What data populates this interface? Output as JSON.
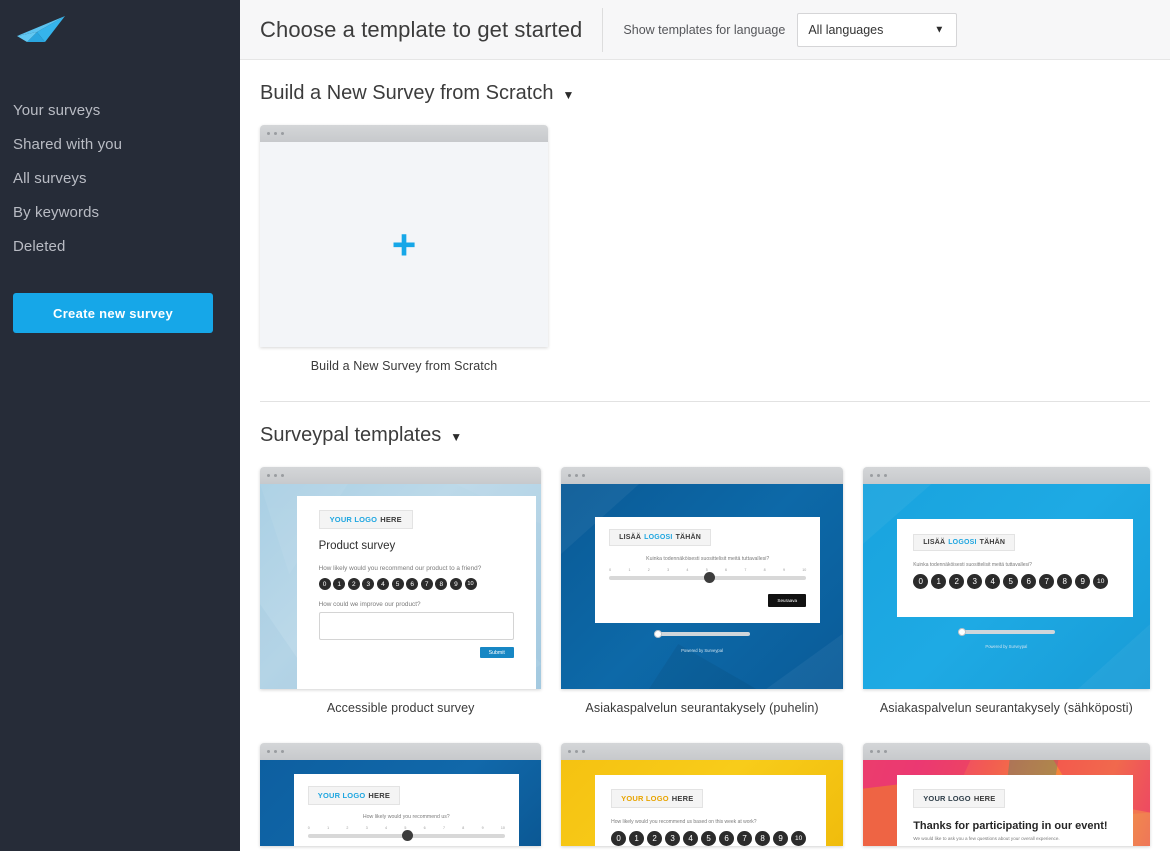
{
  "brand": {
    "logo_icon": "paper-plane-icon",
    "accent_color": "#16a7e8",
    "sidebar_color": "#262c38"
  },
  "sidebar": {
    "items": [
      {
        "label": "Your surveys"
      },
      {
        "label": "Shared with you"
      },
      {
        "label": "All surveys"
      },
      {
        "label": "By keywords"
      },
      {
        "label": "Deleted"
      }
    ],
    "create_button": "Create new survey"
  },
  "header": {
    "title": "Choose a template to get started",
    "language_label": "Show templates for language",
    "language_value": "All languages",
    "caret_icon": "chevron-down-icon"
  },
  "sections": [
    {
      "heading": "Build a New Survey from Scratch",
      "caret_icon": "caret-down-icon",
      "cards": [
        {
          "label": "Build a New Survey from Scratch",
          "thumb_kind": "scratch",
          "plus_icon": "plus-icon"
        }
      ]
    },
    {
      "heading": "Surveypal templates",
      "caret_icon": "caret-down-icon",
      "cards": [
        {
          "label": "Accessible product survey",
          "thumb_kind": "nps-text",
          "background": "#b0d2e6",
          "logo": {
            "highlight": "YOUR LOGO",
            "rest": "HERE"
          },
          "survey_title": "Product survey",
          "question_1": "How likely would you recommend our product to a friend?",
          "scale": [
            "0",
            "1",
            "2",
            "3",
            "4",
            "5",
            "6",
            "7",
            "8",
            "9",
            "10"
          ],
          "question_2": "How could we improve our product?",
          "submit_label": "Submit"
        },
        {
          "label": "Asiakaspalvelun seurantakysely (puhelin)",
          "thumb_kind": "slider",
          "background": "#0d69a8",
          "logo": {
            "pre": "LISÄÄ",
            "highlight": "LOGOSI",
            "rest": "TÄHÄN"
          },
          "question_1": "Kuinka todennäköisesti suosittelisit meitä tuttavallesi?",
          "scale": [
            "0",
            "1",
            "2",
            "3",
            "4",
            "5",
            "6",
            "7",
            "8",
            "9",
            "10"
          ],
          "next_label": "Seuraava",
          "powered_by": "Powered by Surveypal"
        },
        {
          "label": "Asiakaspalvelun seurantakysely (sähköposti)",
          "thumb_kind": "nps-only",
          "background": "#1eaae4",
          "logo": {
            "pre": "LISÄÄ",
            "highlight": "LOGOSI",
            "rest": "TÄHÄN"
          },
          "question_1": "Kuinka todennäköisesti suosittelisit meitä tuttavallesi?",
          "scale": [
            "0",
            "1",
            "2",
            "3",
            "4",
            "5",
            "6",
            "7",
            "8",
            "9",
            "10"
          ],
          "powered_by": "Powered by Surveypal"
        }
      ]
    }
  ],
  "partial_row": {
    "cards": [
      {
        "thumb_kind": "slider",
        "background": "#0d5fa0",
        "logo": {
          "highlight": "YOUR LOGO",
          "rest": "HERE"
        },
        "question_1": "How likely would you recommend us?",
        "scale": [
          "0",
          "1",
          "2",
          "3",
          "4",
          "5",
          "6",
          "7",
          "8",
          "9",
          "10"
        ]
      },
      {
        "thumb_kind": "nps-only",
        "background": "#f8cc1a",
        "logo": {
          "highlight": "YOUR LOGO",
          "rest": "HERE"
        },
        "question_1": "How likely would you recommend us based on this week at work?",
        "scale": [
          "0",
          "1",
          "2",
          "3",
          "4",
          "5",
          "6",
          "7",
          "8",
          "9",
          "10"
        ]
      },
      {
        "thumb_kind": "thanks",
        "background": "#f0476e",
        "logo": {
          "highlight": "YOUR LOGO",
          "rest": "HERE"
        },
        "survey_title": "Thanks for participating in our event!",
        "subtitle": "We would like to ask you a few questions about your overall experience."
      }
    ]
  }
}
